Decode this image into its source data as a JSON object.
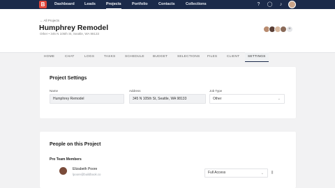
{
  "nav": {
    "logo": "B",
    "links": [
      "Dashboard",
      "Leads",
      "Projects",
      "Portfolio",
      "Contacts",
      "Collections"
    ],
    "active": "Projects",
    "icons": [
      "help-icon",
      "chat-icon",
      "bell-icon",
      "user-avatar"
    ]
  },
  "project": {
    "back_link": "← All Projects",
    "title": "Humphrey Remodel",
    "subline": "Other  •  345 N 105th St, Seattle, WA 98133"
  },
  "tabs": [
    "HOME",
    "CHAT",
    "LOGS",
    "TASKS",
    "SCHEDULE",
    "BUDGET",
    "SELECTIONS",
    "FILES",
    "CLIENT",
    "SETTINGS"
  ],
  "active_tab": "SETTINGS",
  "settings": {
    "title": "Project Settings",
    "name_label": "Name",
    "name_value": "Humphrey Remodel",
    "address_label": "Address",
    "address_value": "345 N 105th St, Seattle, WA 98133",
    "type_label": "Job Type",
    "type_value": "Other"
  },
  "people": {
    "title": "People on this Project",
    "section": "Pro Team Members",
    "member_name": "Elizabeth Poore",
    "member_email": "lpoore@buildbook.co",
    "access_value": "Full Access"
  },
  "colors": {
    "nav_bg": "#1b2a4a",
    "logo": "#e0453a",
    "page_bg": "#f2f2f3"
  }
}
